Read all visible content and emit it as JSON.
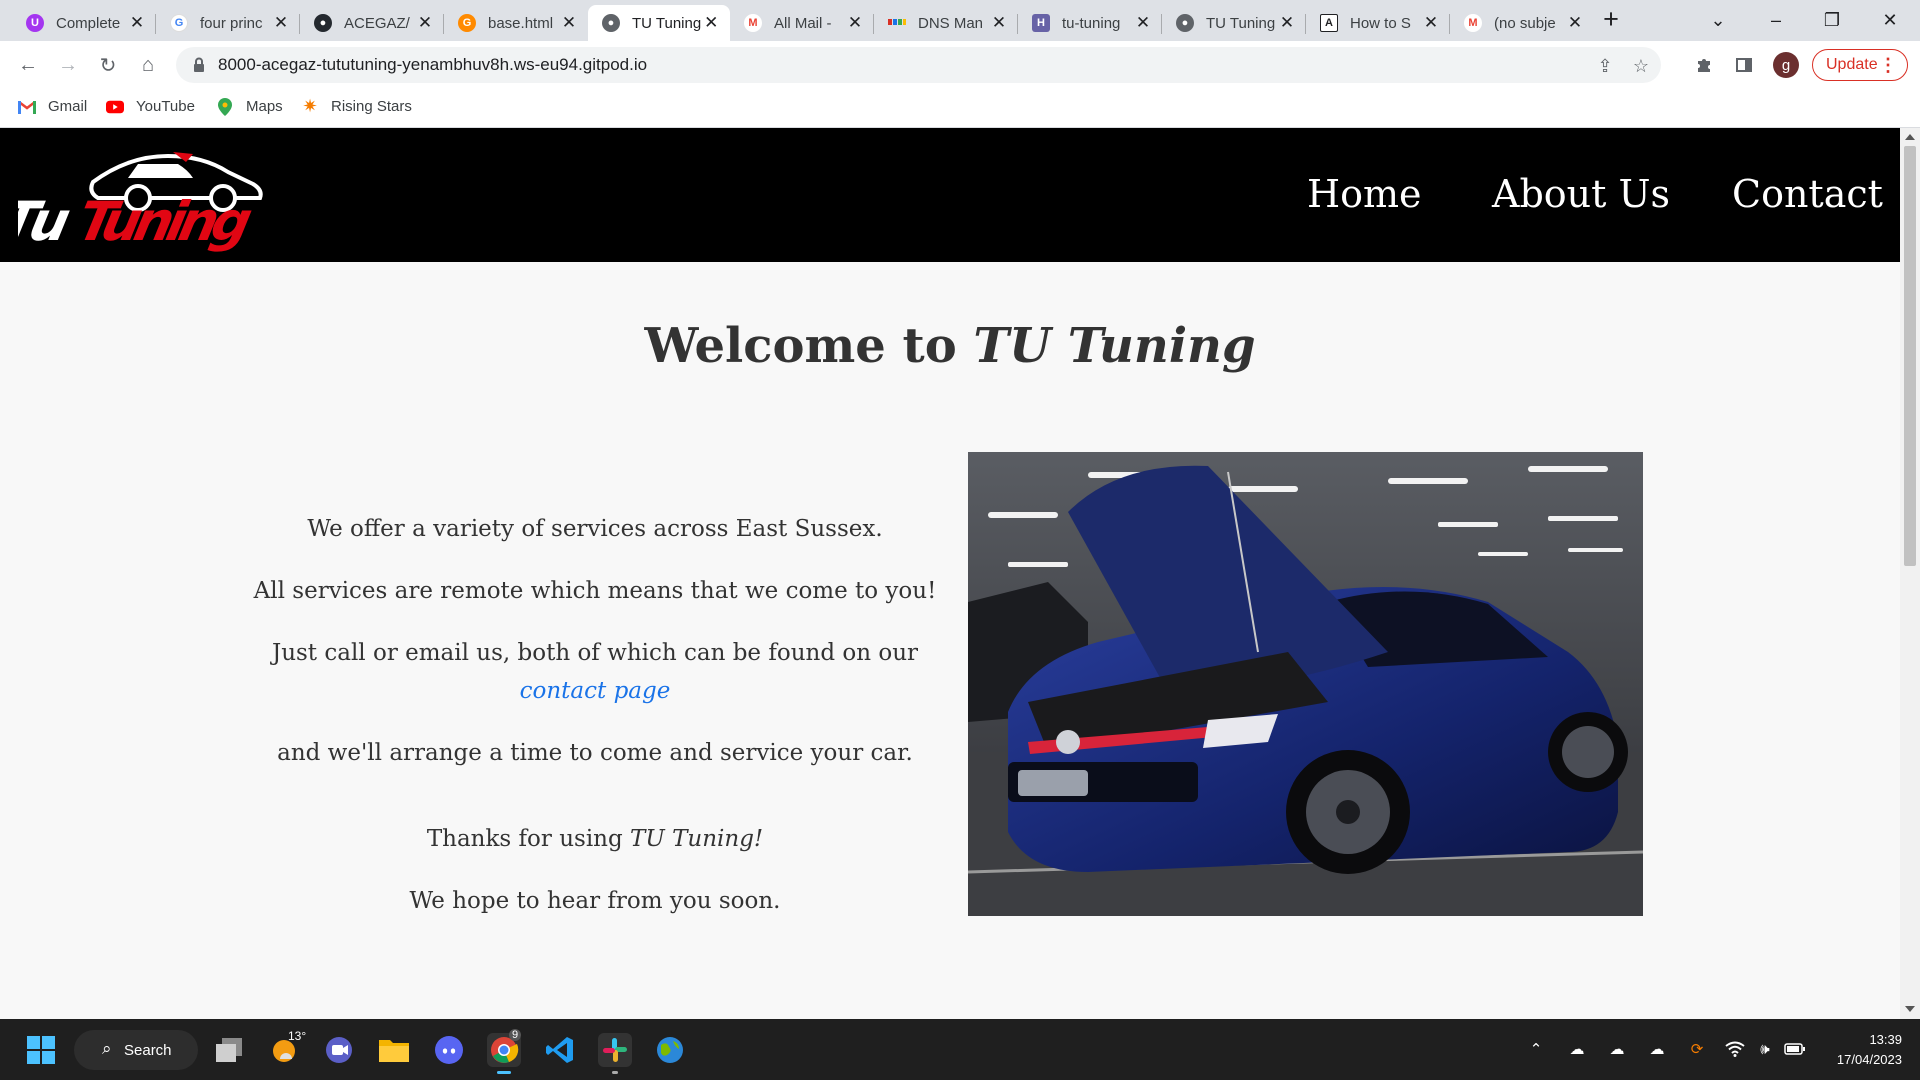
{
  "browser": {
    "tabs": [
      {
        "title": "Complete",
        "icon": "udemy-icon",
        "color": "#a435f0",
        "glyph": "U"
      },
      {
        "title": "four princ",
        "icon": "google-icon",
        "color": "#4285f4",
        "glyph": "G"
      },
      {
        "title": "ACEGAZ/",
        "icon": "github-icon",
        "color": "#24292f",
        "glyph": "●"
      },
      {
        "title": "base.html",
        "icon": "gitpod-icon",
        "color": "#ff8a00",
        "glyph": "G"
      },
      {
        "title": "TU Tuning",
        "icon": "globe-icon",
        "color": "#5f6368",
        "glyph": "●"
      },
      {
        "title": "All Mail -",
        "icon": "gmail-icon",
        "color": "#ea4335",
        "glyph": "M"
      },
      {
        "title": "DNS Man",
        "icon": "dns-icon",
        "color": "#34a853",
        "glyph": "▪"
      },
      {
        "title": "tu-tuning",
        "icon": "heroku-icon",
        "color": "#6762a6",
        "glyph": "H"
      },
      {
        "title": "TU Tuning",
        "icon": "globe-icon",
        "color": "#5f6368",
        "glyph": "●"
      },
      {
        "title": "How to S",
        "icon": "doc-icon",
        "color": "#202124",
        "glyph": "A"
      },
      {
        "title": "(no subje",
        "icon": "gmail-icon",
        "color": "#ea4335",
        "glyph": "M"
      }
    ],
    "active_tab": 4,
    "url": "8000-acegaz-tututuning-yenambhuv8h.ws-eu94.gitpod.io",
    "update_label": "Update",
    "avatar_letter": "g",
    "bookmarks": [
      {
        "label": "Gmail",
        "icon": "gmail-icon"
      },
      {
        "label": "YouTube",
        "icon": "youtube-icon"
      },
      {
        "label": "Maps",
        "icon": "maps-icon"
      },
      {
        "label": "Rising Stars",
        "icon": "star-icon"
      }
    ]
  },
  "site": {
    "logo_text": "Tu Tuning",
    "nav": [
      "Home",
      "About Us",
      "Contact"
    ],
    "welcome_prefix": "Welcome to ",
    "welcome_brand": "TU Tuning",
    "para1": "We offer a variety of services across East Sussex.",
    "para2": "All services are remote which means that we come to you!",
    "para3": "Just call or email us, both of which can be found on our",
    "contact_link": "contact page",
    "para4": "and we'll arrange a time to come and service your car.",
    "thanks_prefix": "Thanks for using ",
    "thanks_brand": "TU Tuning!",
    "closing": "We hope to hear from you soon.",
    "image_alt": "blue hatchback with bonnet open in a car park"
  },
  "taskbar": {
    "search_label": "Search",
    "weather_temp": "13°",
    "chrome_badge": "9",
    "time": "13:39",
    "date": "17/04/2023"
  }
}
